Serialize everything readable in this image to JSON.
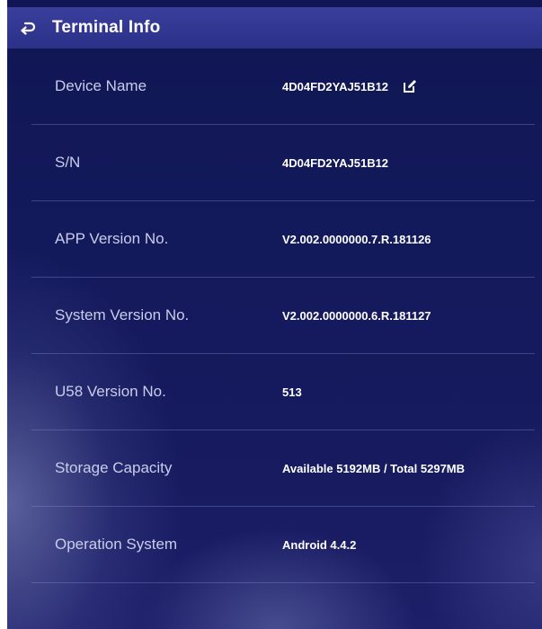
{
  "header": {
    "title": "Terminal Info",
    "back_icon": "back-arrow-icon"
  },
  "rows": [
    {
      "label": "Device Name",
      "value": "4D04FD2YAJ51B12",
      "editable": true,
      "edit_icon": "edit-icon"
    },
    {
      "label": "S/N",
      "value": "4D04FD2YAJ51B12"
    },
    {
      "label": "APP Version No.",
      "value": "V2.002.0000000.7.R.181126"
    },
    {
      "label": "System Version No.",
      "value": "V2.002.0000000.6.R.181127"
    },
    {
      "label": "U58 Version No.",
      "value": "513"
    },
    {
      "label": "Storage Capacity",
      "value": "Available 5192MB / Total 5297MB"
    },
    {
      "label": "Operation System",
      "value": "Android 4.4.2"
    }
  ],
  "colors": {
    "background": "#131a5c",
    "header": "#2e3390",
    "text": "#ffffff",
    "label_text": "#c9cdea"
  }
}
